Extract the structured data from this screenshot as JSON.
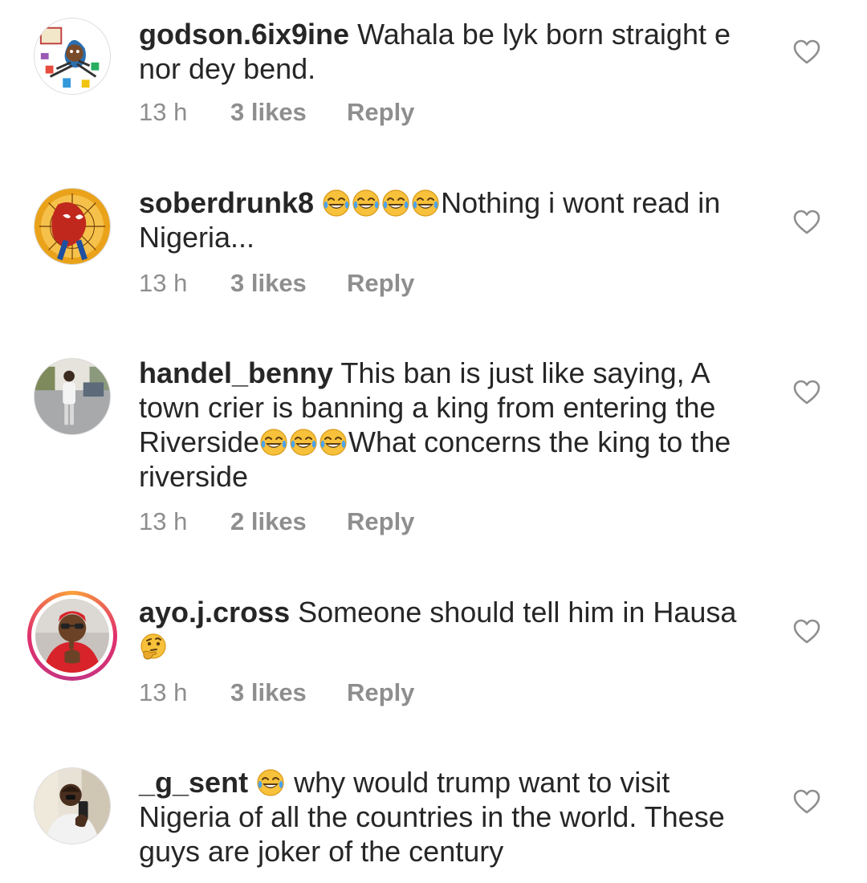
{
  "comments": [
    {
      "username": "godson.6ix9ine",
      "segments": [
        "Wahala be lyk born straight e nor dey bend."
      ],
      "time": "13 h",
      "likes": "3 likes",
      "reply": "Reply",
      "avatar_icon": "cartoon-avatar",
      "story_ring": false
    },
    {
      "username": "soberdrunk8",
      "segments": [
        "Nothing i wont read in Nigeria..."
      ],
      "emoji_prefix": [
        "face-with-tears-of-joy",
        "face-with-tears-of-joy",
        "face-with-tears-of-joy",
        "face-with-tears-of-joy"
      ],
      "time": "13 h",
      "likes": "3 likes",
      "reply": "Reply",
      "avatar_icon": "spiderman-avatar",
      "story_ring": false
    },
    {
      "username": "handel_benny",
      "segments": [
        "This ban is just like saying, A town crier is banning a king from entering the Riverside",
        "What concerns the king to the riverside"
      ],
      "emoji_between": [
        "face-with-tears-of-joy",
        "face-with-tears-of-joy",
        "face-with-tears-of-joy"
      ],
      "time": "13 h",
      "likes": "2 likes",
      "reply": "Reply",
      "avatar_icon": "person-standing-avatar",
      "story_ring": false
    },
    {
      "username": "ayo.j.cross",
      "segments": [
        "Someone should tell him in Hausa"
      ],
      "emoji_suffix": [
        "thinking-face"
      ],
      "time": "13 h",
      "likes": "3 likes",
      "reply": "Reply",
      "avatar_icon": "man-in-red-avatar",
      "story_ring": true,
      "story_colors": [
        "#f9a13a",
        "#e1306c",
        "#c13584"
      ]
    },
    {
      "username": "_g_sent",
      "segments": [
        "why would trump want to visit Nigeria of all the countries in the world.  These guys are joker of the century"
      ],
      "emoji_prefix": [
        "face-with-tears-of-joy"
      ],
      "time": "",
      "likes": "",
      "reply": "",
      "avatar_icon": "selfie-avatar",
      "story_ring": false
    }
  ],
  "colors": {
    "text": "#262626",
    "muted": "#8e8e8e",
    "heart_outline": "#8e8e8e",
    "emoji_face": "#f7c13b"
  },
  "icons": {
    "like": "heart-outline-icon"
  }
}
